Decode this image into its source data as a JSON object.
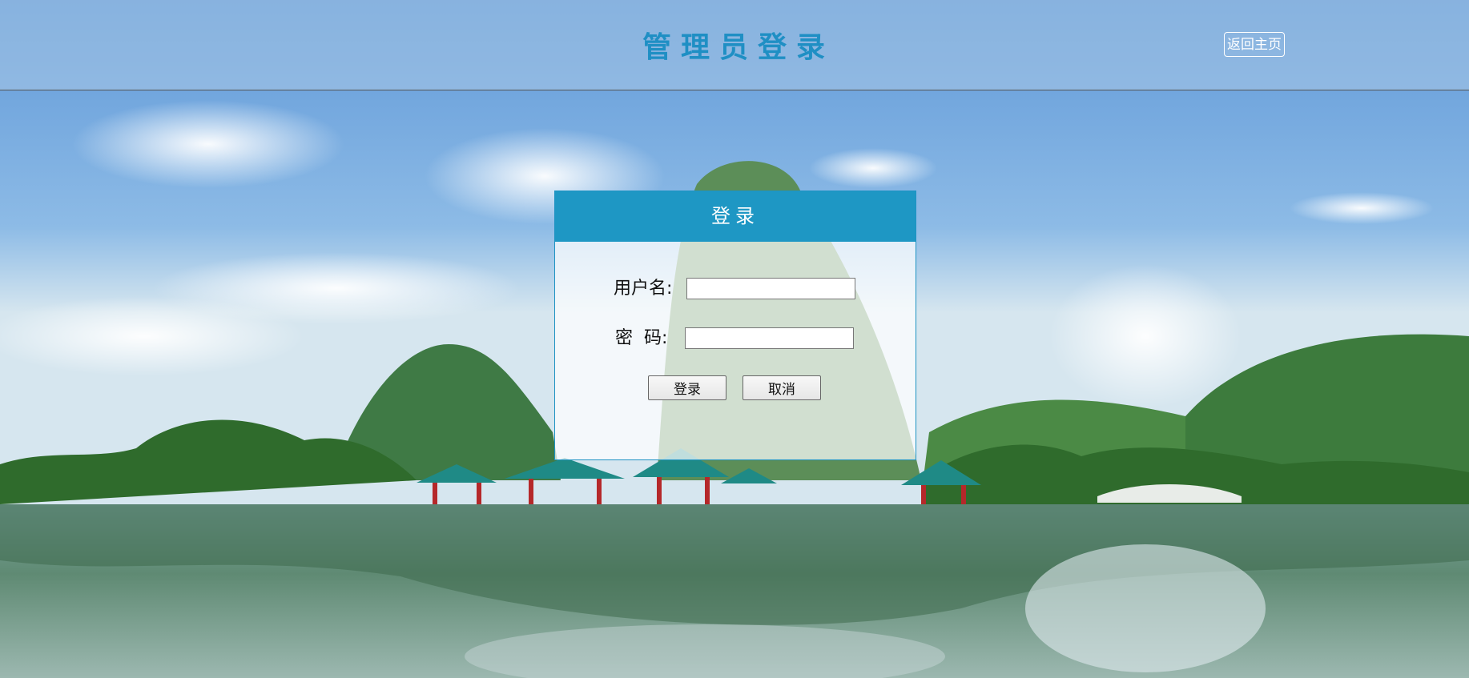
{
  "header": {
    "title": "管理员登录",
    "back_home_label": "返回主页"
  },
  "login": {
    "heading": "登录",
    "username_label": "用户名:",
    "password_label": "密  码:",
    "username_value": "",
    "password_value": "",
    "submit_label": "登录",
    "cancel_label": "取消"
  },
  "colors": {
    "accent": "#1e97c4",
    "title": "#1f8fc4"
  }
}
